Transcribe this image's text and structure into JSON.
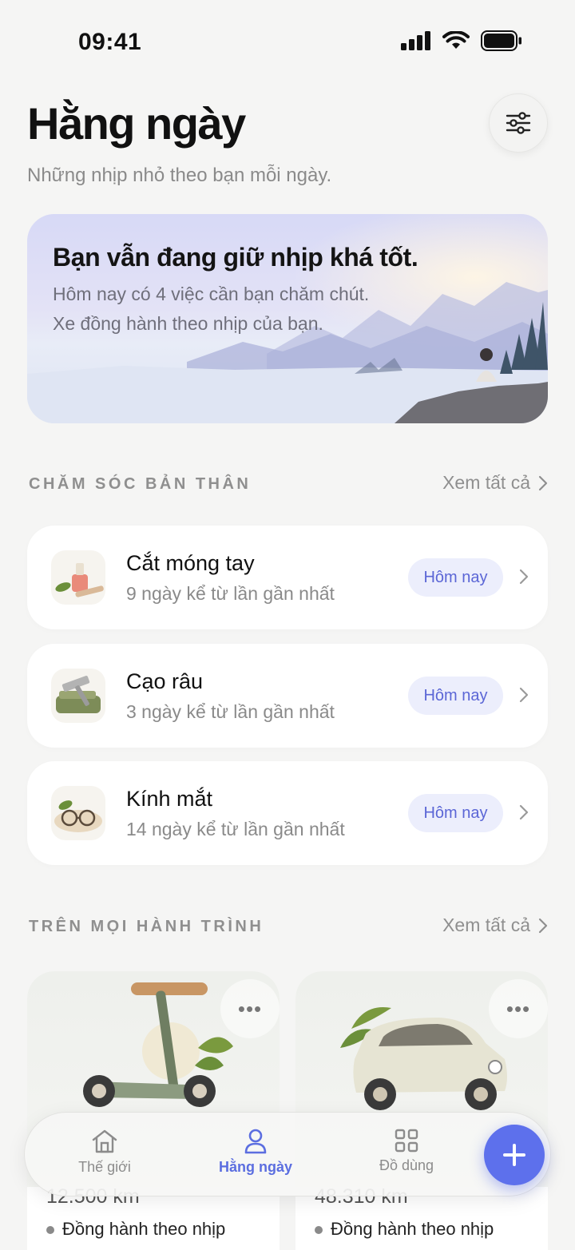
{
  "status_bar": {
    "time": "09:41"
  },
  "header": {
    "title": "Hằng ngày",
    "subtitle": "Những nhịp nhỏ theo bạn mỗi ngày."
  },
  "banner": {
    "title": "Bạn vẫn đang giữ nhịp khá tốt.",
    "line1": "Hôm nay có 4 việc cần bạn chăm chút.",
    "line2": "Xe đồng hành theo nhịp của bạn."
  },
  "self_care": {
    "section_label": "CHĂM SÓC BẢN THÂN",
    "see_all": "Xem tất cả",
    "items": [
      {
        "title": "Cắt móng tay",
        "subtitle": "9 ngày kể từ lần gần nhất",
        "badge": "Hôm nay",
        "icon": "nail-polish-icon"
      },
      {
        "title": "Cạo râu",
        "subtitle": "3 ngày kể từ lần gần nhất",
        "badge": "Hôm nay",
        "icon": "razor-icon"
      },
      {
        "title": "Kính mắt",
        "subtitle": "14 ngày kể từ lần gần nhất",
        "badge": "Hôm nay",
        "icon": "glasses-icon"
      }
    ]
  },
  "journey": {
    "section_label": "TRÊN MỌI HÀNH TRÌNH",
    "see_all": "Xem tất cả",
    "items": [
      {
        "km": "12.500 km",
        "note": "Đồng hành theo nhịp",
        "icon": "scooter-icon"
      },
      {
        "km": "48.310 km",
        "note": "Đồng hành theo nhịp",
        "icon": "car-icon"
      }
    ]
  },
  "tab_bar": {
    "tabs": [
      {
        "label": "Thế giới",
        "icon": "home-icon"
      },
      {
        "label": "Hằng ngày",
        "icon": "person-icon"
      },
      {
        "label": "Đồ dùng",
        "icon": "grid-icon"
      }
    ],
    "active": "Hằng ngày"
  },
  "colors": {
    "accent": "#5d70ec",
    "badge_bg": "#eceefc",
    "badge_text": "#5b66d6"
  }
}
